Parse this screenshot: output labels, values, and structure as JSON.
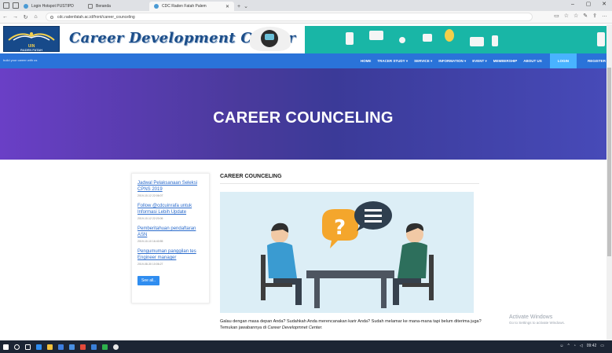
{
  "browser": {
    "tabs": [
      {
        "label": "Login Hotspot PUSTIPD"
      },
      {
        "label": "Beranda"
      },
      {
        "label": "CDC Raden Fatah Palem"
      }
    ],
    "url": "cdc.radenfatah.ac.id/front/career_counceling"
  },
  "site": {
    "brand": "Career Development Center",
    "logo_text": "UIN",
    "logo_subtext": "RADEN FATAH",
    "tagline": "build your career with us",
    "nav": [
      {
        "label": "HOME"
      },
      {
        "label": "TRACER STUDY ▾"
      },
      {
        "label": "SERVICE ▾"
      },
      {
        "label": "INFORMATION ▾"
      },
      {
        "label": "EVENT ▾"
      },
      {
        "label": "MEMBERSHIP"
      },
      {
        "label": "ABOUT US"
      }
    ],
    "login": "LOGIN",
    "register": "REGISTER"
  },
  "hero": {
    "title": "CAREER COUNCELING"
  },
  "sidebar": {
    "posts": [
      {
        "title": "Jadwal Pelaksanaan Seleksi CPNS 2019",
        "date": "2019-10-12 22:06:07"
      },
      {
        "title": "Follow @cdcuinrafa untuk Informasi Lebih Update",
        "date": "2019-10-12 22:20:06"
      },
      {
        "title": "Pemberitahuan pendaftaran ASN",
        "date": "2019-10-10 16:40:55"
      },
      {
        "title": "Pengumuman panggilan tes Engineer manager",
        "date": "2019-08-30 10:06:27"
      }
    ],
    "see_all": "See all.."
  },
  "content": {
    "title": "CAREER COUNCELING",
    "paragraph": "Galau dengan masa depan Anda? Sudahkah Anda merencanakan karir Anda? Sudah melamar ke mana-mana tapi belum diterima juga? Temukan jawabannya di ",
    "paragraph_em": "Career Developmnet Center."
  },
  "watermark": {
    "line1": "Activate Windows",
    "line2": "Go to Settings to activate Windows."
  },
  "taskbar": {
    "time": "09:42"
  }
}
